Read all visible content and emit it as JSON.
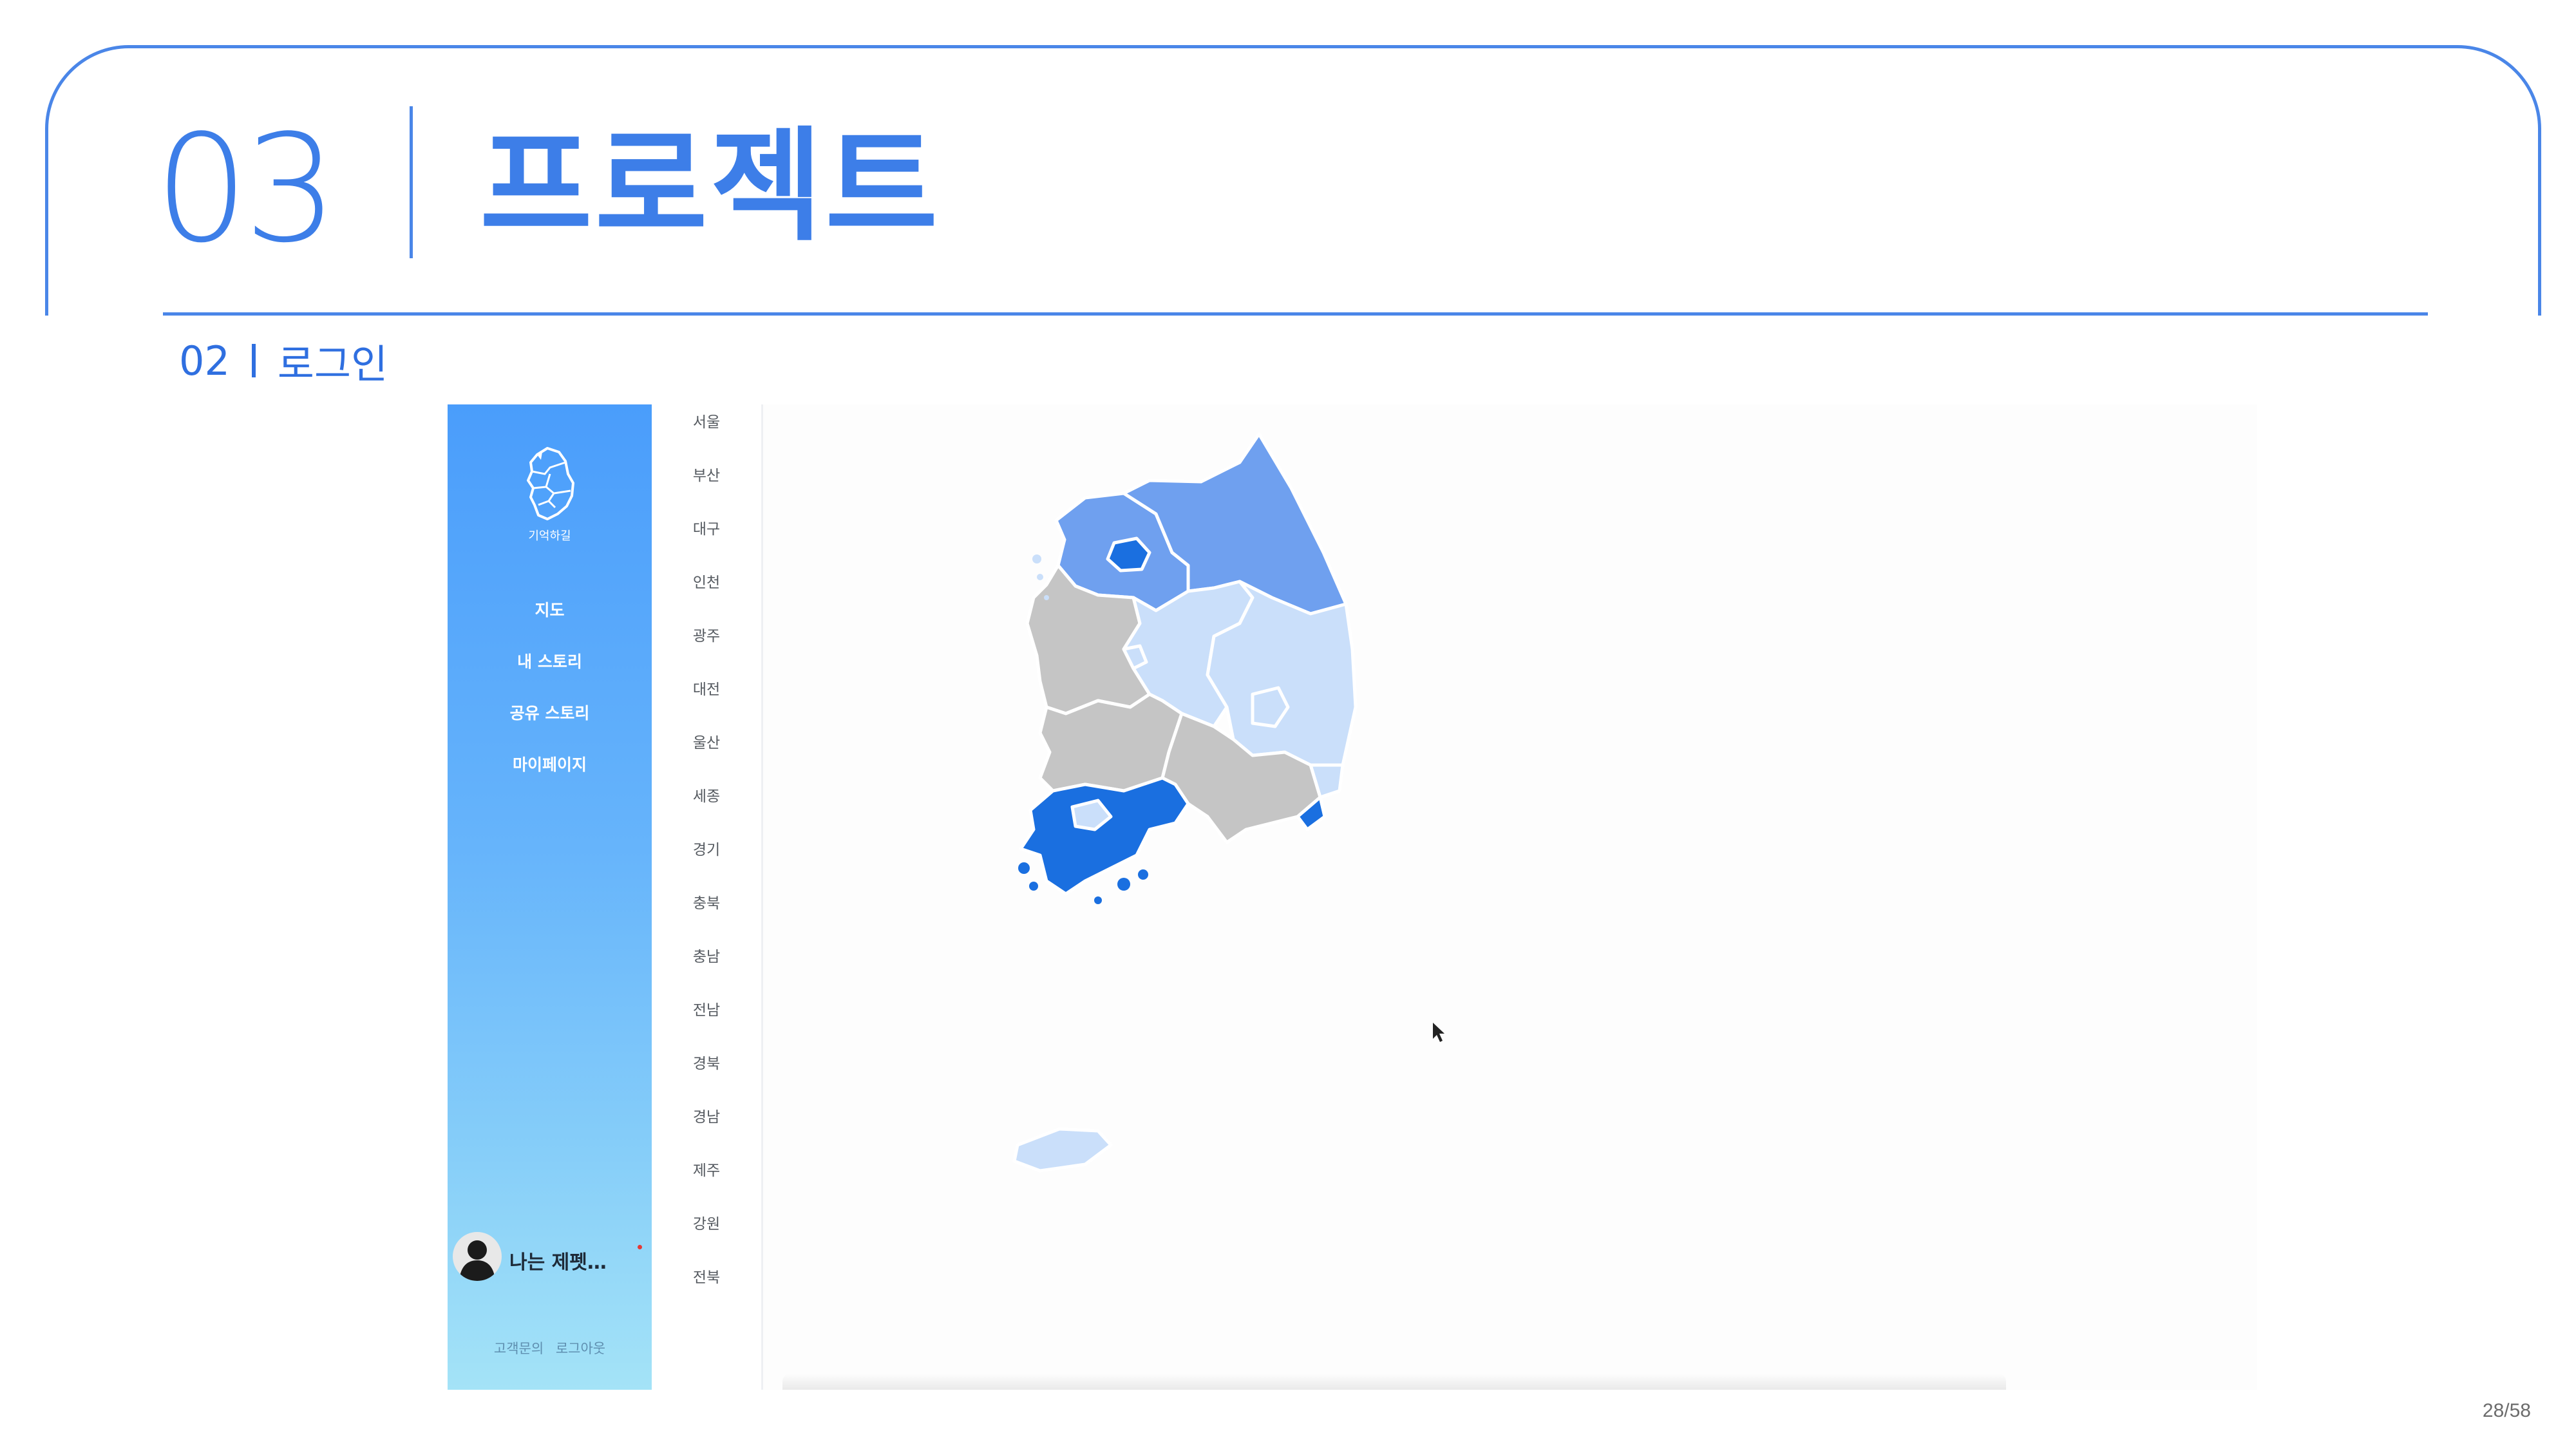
{
  "slide": {
    "section_number": "03",
    "section_title": "프로젝트",
    "subsection_number": "02",
    "subsection_title": "로그인",
    "page_number": "28/58",
    "accent_color": "#4a86e8"
  },
  "app": {
    "logo_text": "기억하길",
    "nav": [
      "지도",
      "내 스토리",
      "공유 스토리",
      "마이페이지"
    ],
    "user": {
      "name": "나는 제펫…"
    },
    "footer": {
      "contact": "고객문의",
      "logout": "로그아웃"
    },
    "regions": [
      "서울",
      "부산",
      "대구",
      "인천",
      "광주",
      "대전",
      "울산",
      "세종",
      "경기",
      "충북",
      "충남",
      "전남",
      "경북",
      "경남",
      "제주",
      "강원",
      "전북"
    ],
    "map_colors": {
      "darkest": "#1a6fe0",
      "dark": "#6fa0ef",
      "light": "#cadffa",
      "empty": "#c5c5c5"
    }
  }
}
